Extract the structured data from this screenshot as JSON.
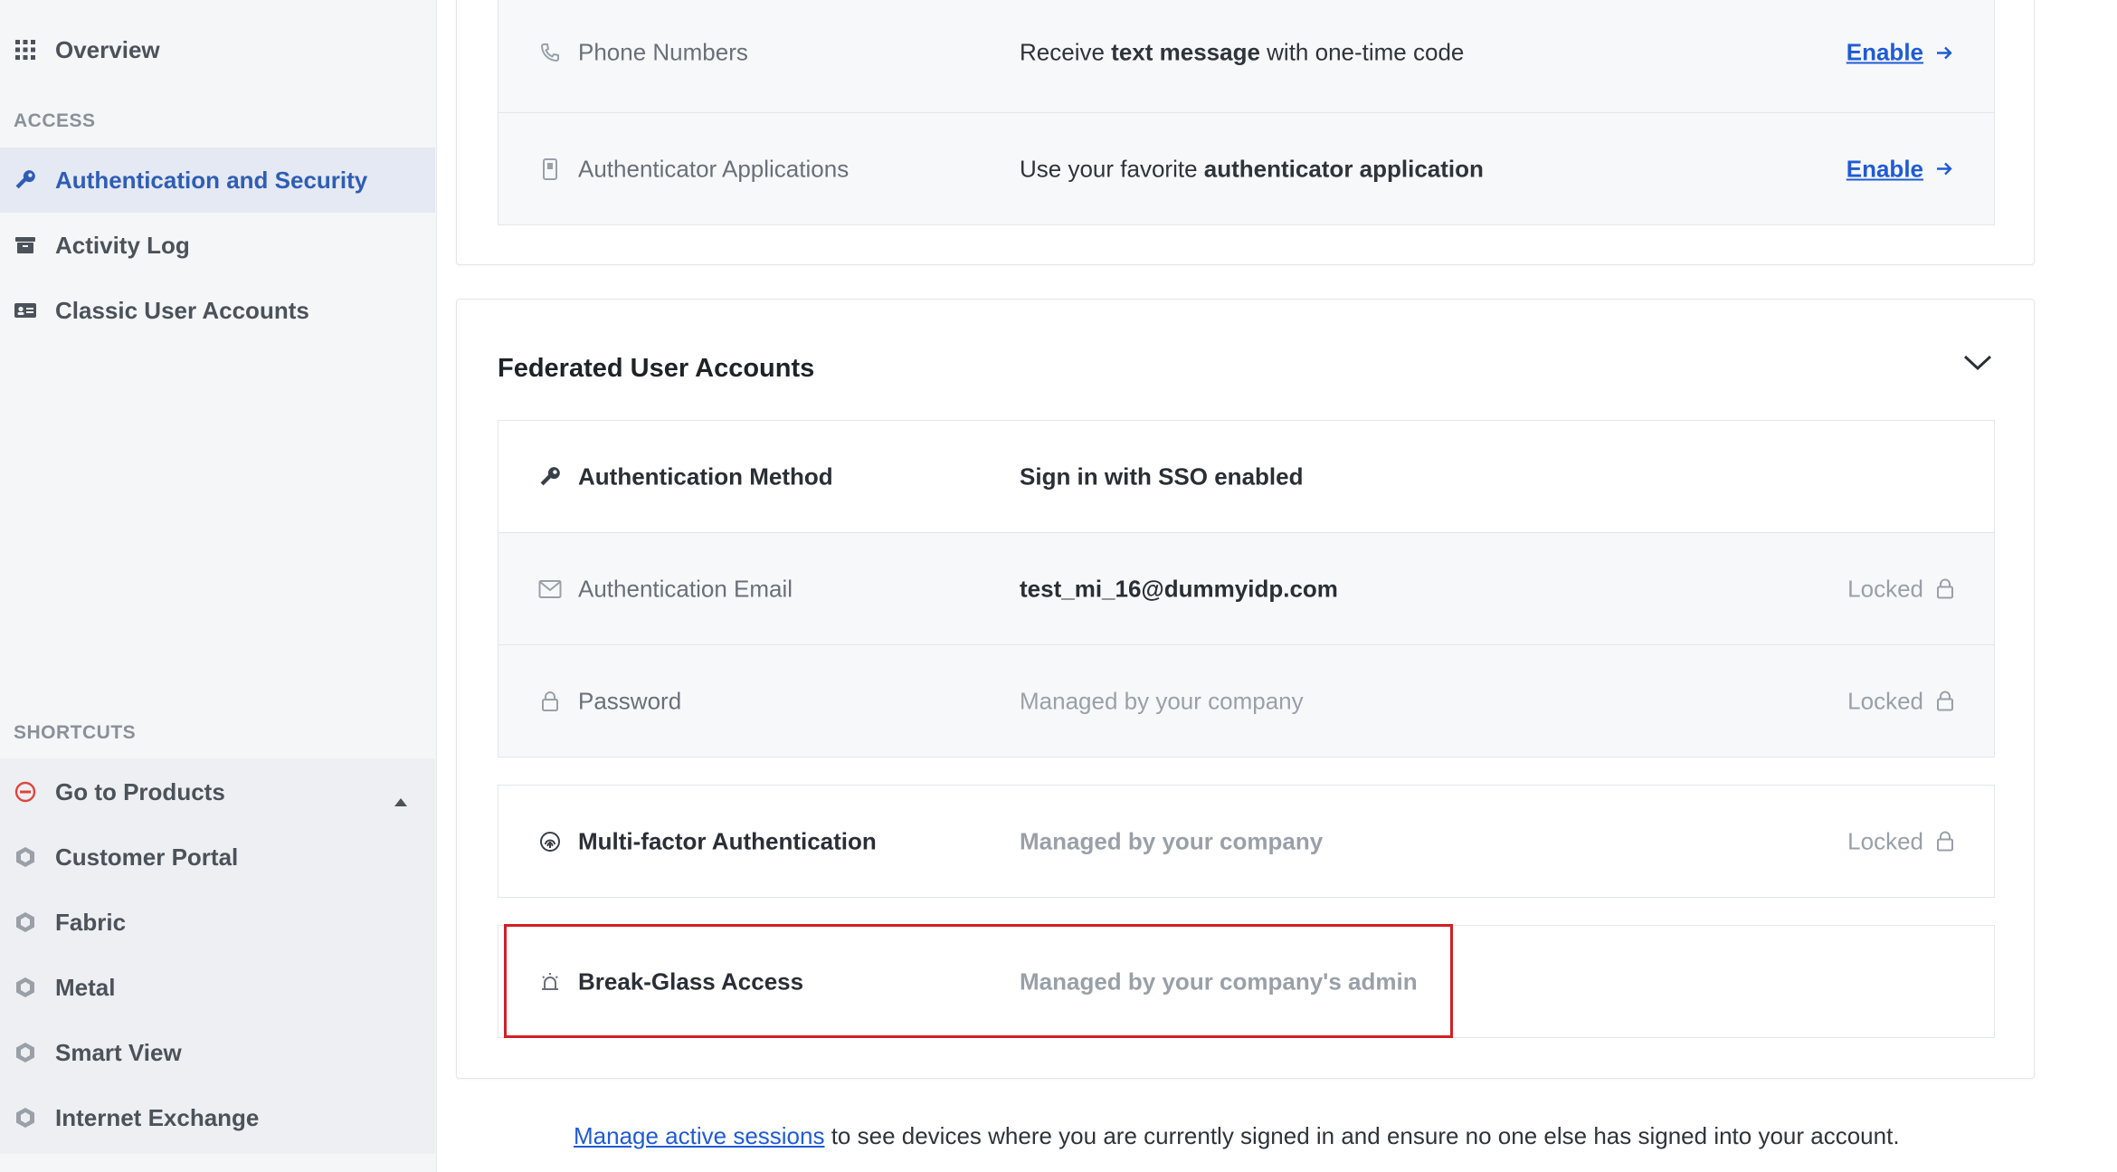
{
  "sidebar": {
    "overview": {
      "label": "Overview",
      "icon": "grid-icon"
    },
    "access_heading": "ACCESS",
    "access_items": [
      {
        "label": "Authentication and Security",
        "icon": "key-icon",
        "active": true
      },
      {
        "label": "Activity Log",
        "icon": "archive-icon",
        "active": false
      },
      {
        "label": "Classic User Accounts",
        "icon": "id-card-icon",
        "active": false
      }
    ],
    "shortcuts_heading": "SHORTCUTS",
    "shortcut_items": [
      {
        "label": "Go to Products",
        "icon": "products-icon",
        "expanded": true
      },
      {
        "label": "Customer Portal",
        "icon": "hexagon-icon"
      },
      {
        "label": "Fabric",
        "icon": "hexagon-icon"
      },
      {
        "label": "Metal",
        "icon": "hexagon-icon"
      },
      {
        "label": "Smart View",
        "icon": "hexagon-icon"
      },
      {
        "label": "Internet Exchange",
        "icon": "hexagon-icon"
      }
    ]
  },
  "mfa_card": {
    "rows": [
      {
        "label": "Phone Numbers",
        "desc_pre": "Receive ",
        "desc_bold": "text message",
        "desc_post": " with one-time code",
        "action": "Enable"
      },
      {
        "label": "Authenticator Applications",
        "desc_pre": "Use your favorite ",
        "desc_bold": "authenticator application",
        "desc_post": "",
        "action": "Enable"
      }
    ]
  },
  "federated_card": {
    "title": "Federated User Accounts",
    "rows": [
      {
        "label": "Authentication Method",
        "value": "Sign in with SSO enabled"
      },
      {
        "label": "Authentication Email",
        "value": "test_mi_16@dummyidp.com",
        "status": "Locked"
      },
      {
        "label": "Password",
        "value": "Managed by your company",
        "status": "Locked"
      },
      {
        "label": "Multi-factor Authentication",
        "value": "Managed by your company",
        "status": "Locked"
      },
      {
        "label": "Break-Glass Access",
        "value": "Managed by your company's admin"
      }
    ]
  },
  "footer": {
    "link_text": "Manage active sessions",
    "rest_text": " to see devices where you are currently signed in and ensure no one else has signed into your account."
  },
  "colors": {
    "accent": "#1f5bd6",
    "active_nav": "#2f5db5",
    "highlight": "#d21f26",
    "go_to_products_icon": "#e0443e"
  }
}
